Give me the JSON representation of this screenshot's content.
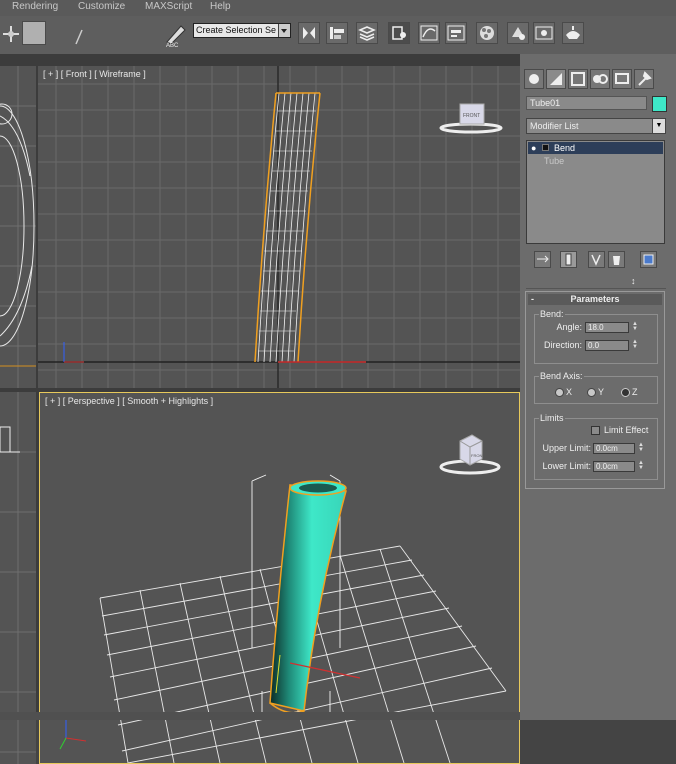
{
  "menus": [
    "Rendering",
    "Customize",
    "MAXScript",
    "Help"
  ],
  "toolbar": {
    "selection_set": "Create Selection Se"
  },
  "viewports": {
    "front": {
      "label": "[ + ] [ Front ] [ Wireframe ]",
      "viewcube_label": "FRONT"
    },
    "perspective": {
      "label": "[ + ] [ Perspective ] [ Smooth + Highlights ]",
      "viewcube_label": "FRONT"
    }
  },
  "command_panel": {
    "object_name": "Tube01",
    "object_color": "#3ee8c8",
    "modifier_list": "Modifier List",
    "stack": [
      {
        "label": "Bend",
        "selected": true
      },
      {
        "label": "Tube",
        "selected": false
      }
    ],
    "rollout": {
      "title": "Parameters",
      "bend_group": "Bend:",
      "angle_label": "Angle:",
      "angle_value": "18.0",
      "direction_label": "Direction:",
      "direction_value": "0.0",
      "axis_group": "Bend Axis:",
      "axes": [
        "X",
        "Y",
        "Z"
      ],
      "limits_group": "Limits",
      "limit_effect": "Limit Effect",
      "upper_label": "Upper Limit:",
      "upper_value": "0.0cm",
      "lower_label": "Lower Limit:",
      "lower_value": "0.0cm"
    }
  },
  "colors": {
    "selected_object": "#3ee8c8",
    "active_viewport_border": "#e7c95b",
    "wire_selection": "#f0a020"
  }
}
